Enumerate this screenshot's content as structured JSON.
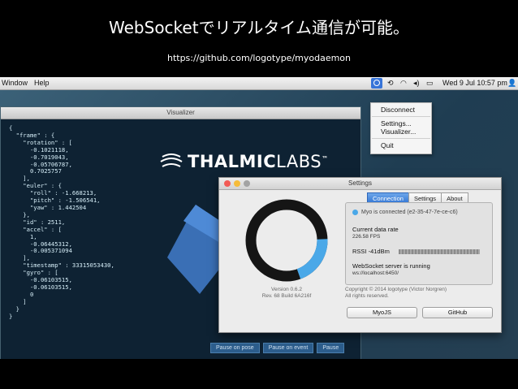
{
  "slide": {
    "title": "WebSocketでリアルタイム通信が可能。",
    "url": "https://github.com/logotype/myodaemon"
  },
  "menubar": {
    "items": [
      "Window",
      "Help"
    ],
    "clock": "Wed 9 Jul  10:57 pm"
  },
  "dropdown_menu": {
    "items": [
      "Disconnect",
      "Settings...",
      "Visualizer...",
      "Quit"
    ]
  },
  "visualizer": {
    "title": "Visualizer",
    "brand_bold": "THALMIC",
    "brand_light": "LABS",
    "brand_tm": "™",
    "json_lines": [
      "{",
      "  \"frame\" : {",
      "    \"rotation\" : [",
      "      -0.1021118,",
      "      -0.7019043,",
      "      -0.05706787,",
      "      0.7025757",
      "    ],",
      "    \"euler\" : {",
      "      \"roll\" : -1.668213,",
      "      \"pitch\" : -1.506541,",
      "      \"yaw\" : 1.442504",
      "    },",
      "    \"id\" : 2511,",
      "    \"accel\" : [",
      "      1,",
      "      -0.06445312,",
      "      -0.005371094",
      "    ],",
      "    \"timestamp\" : 33315053430,",
      "    \"gyro\" : [",
      "      -0.06103515,",
      "      -0.06103515,",
      "      0",
      "    ]",
      "  }",
      "}"
    ],
    "buttons": [
      "Pause on pose",
      "Pause on event",
      "Pause"
    ]
  },
  "settings": {
    "title": "Settings",
    "tabs": [
      "Connection",
      "Settings",
      "About"
    ],
    "status": "Myo is connected (e2-35-47-7e-ce-c6)",
    "data_rate_label": "Current data rate",
    "data_rate_value": "226.58 FPS",
    "rssi_label": "RSSI -41dBm",
    "ws_label": "WebSocket server is running",
    "ws_value": "ws://localhost:6450/",
    "version_line1": "Version 0.6.2",
    "version_line2": "Rev. 68 Build 6A216f",
    "copyright_line1": "Copyright © 2014 logotype (Victor Norgren)",
    "copyright_line2": "All rights reserved.",
    "btn_myojs": "MyoJS",
    "btn_github": "GitHub",
    "donut_fill": 0.2,
    "colors": {
      "accent": "#4aa8e8",
      "tab_active": "#3a7fe0",
      "ring": "#151515"
    }
  }
}
